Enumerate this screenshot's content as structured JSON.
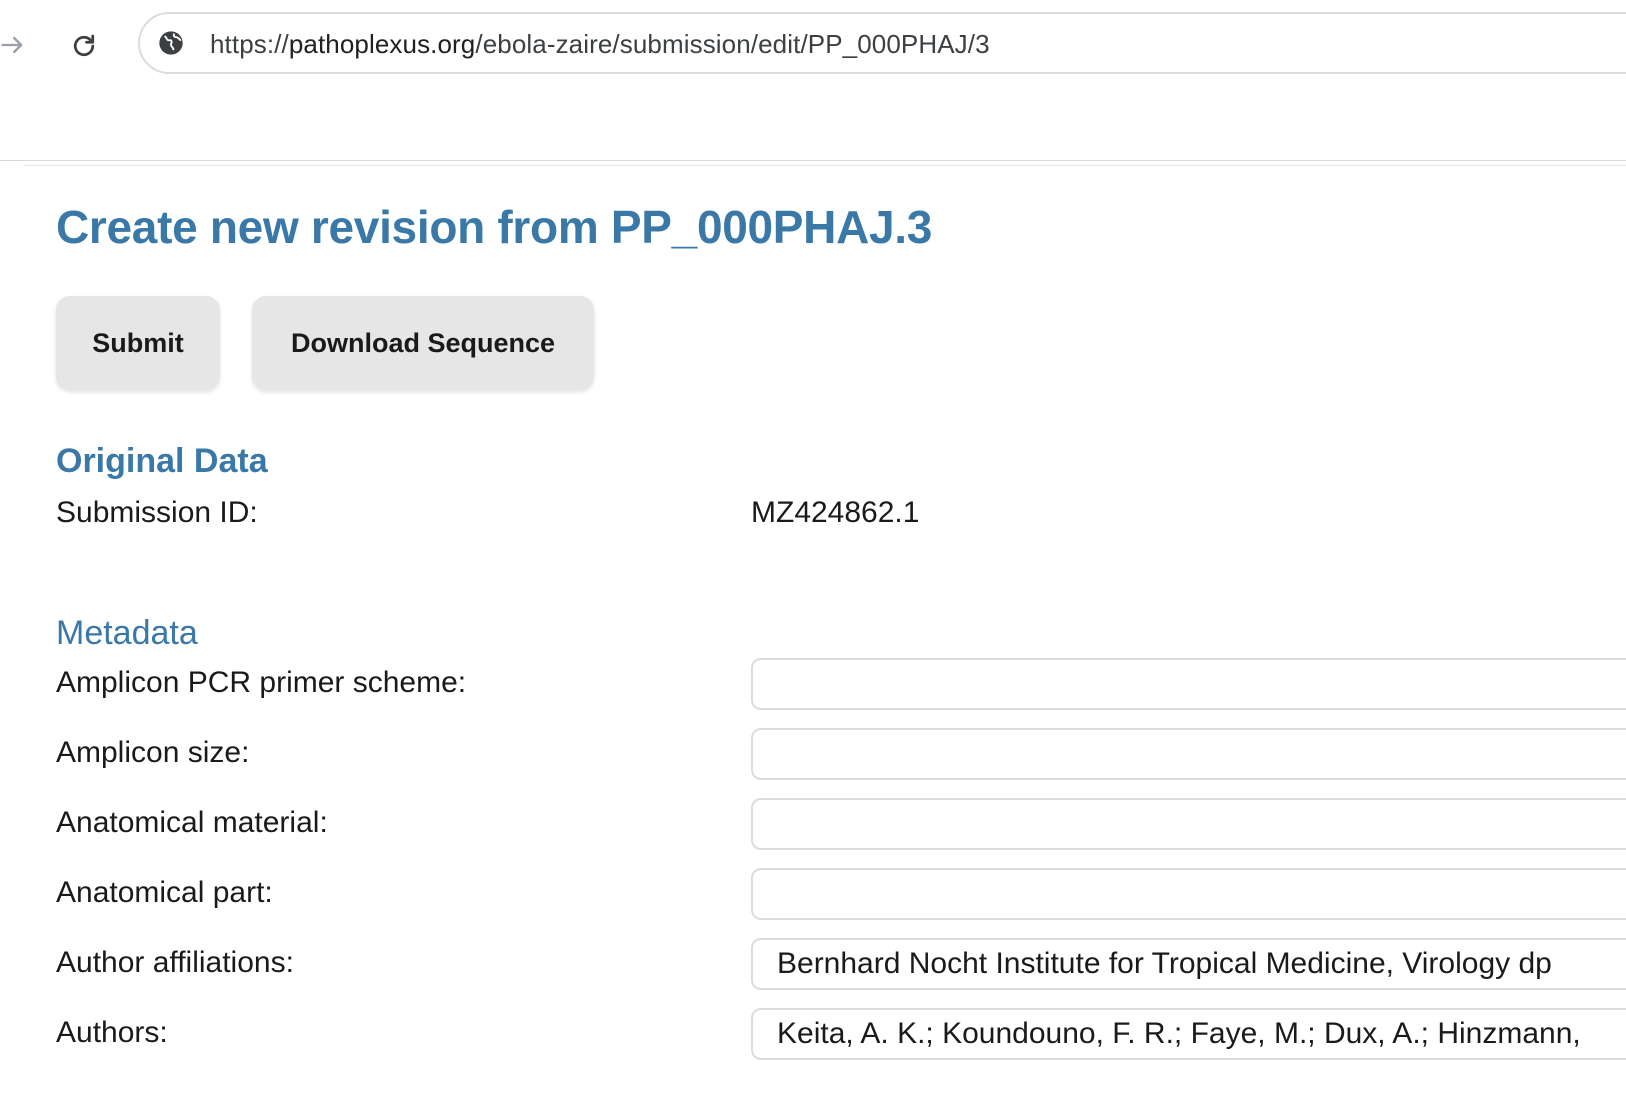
{
  "browser": {
    "url_prefix": "https://",
    "url_host": "pathoplexus.org",
    "url_path": "/ebola-zaire/submission/edit/PP_000PHAJ/3"
  },
  "page": {
    "title": "Create new revision from PP_000PHAJ.3",
    "buttons": {
      "submit": "Submit",
      "download_sequence": "Download Sequence"
    }
  },
  "original_data": {
    "heading": "Original Data",
    "submission_id_label": "Submission ID:",
    "submission_id_value": "MZ424862.1"
  },
  "metadata": {
    "heading": "Metadata",
    "fields": [
      {
        "label": "Amplicon PCR primer scheme:",
        "value": ""
      },
      {
        "label": "Amplicon size:",
        "value": ""
      },
      {
        "label": "Anatomical material:",
        "value": ""
      },
      {
        "label": "Anatomical part:",
        "value": ""
      },
      {
        "label": "Author affiliations:",
        "value": "Bernhard Nocht Institute for Tropical Medicine, Virology dp"
      },
      {
        "label": "Authors:",
        "value": "Keita, A. K.; Koundouno, F. R.; Faye, M.; Dux, A.; Hinzmann,"
      }
    ]
  }
}
